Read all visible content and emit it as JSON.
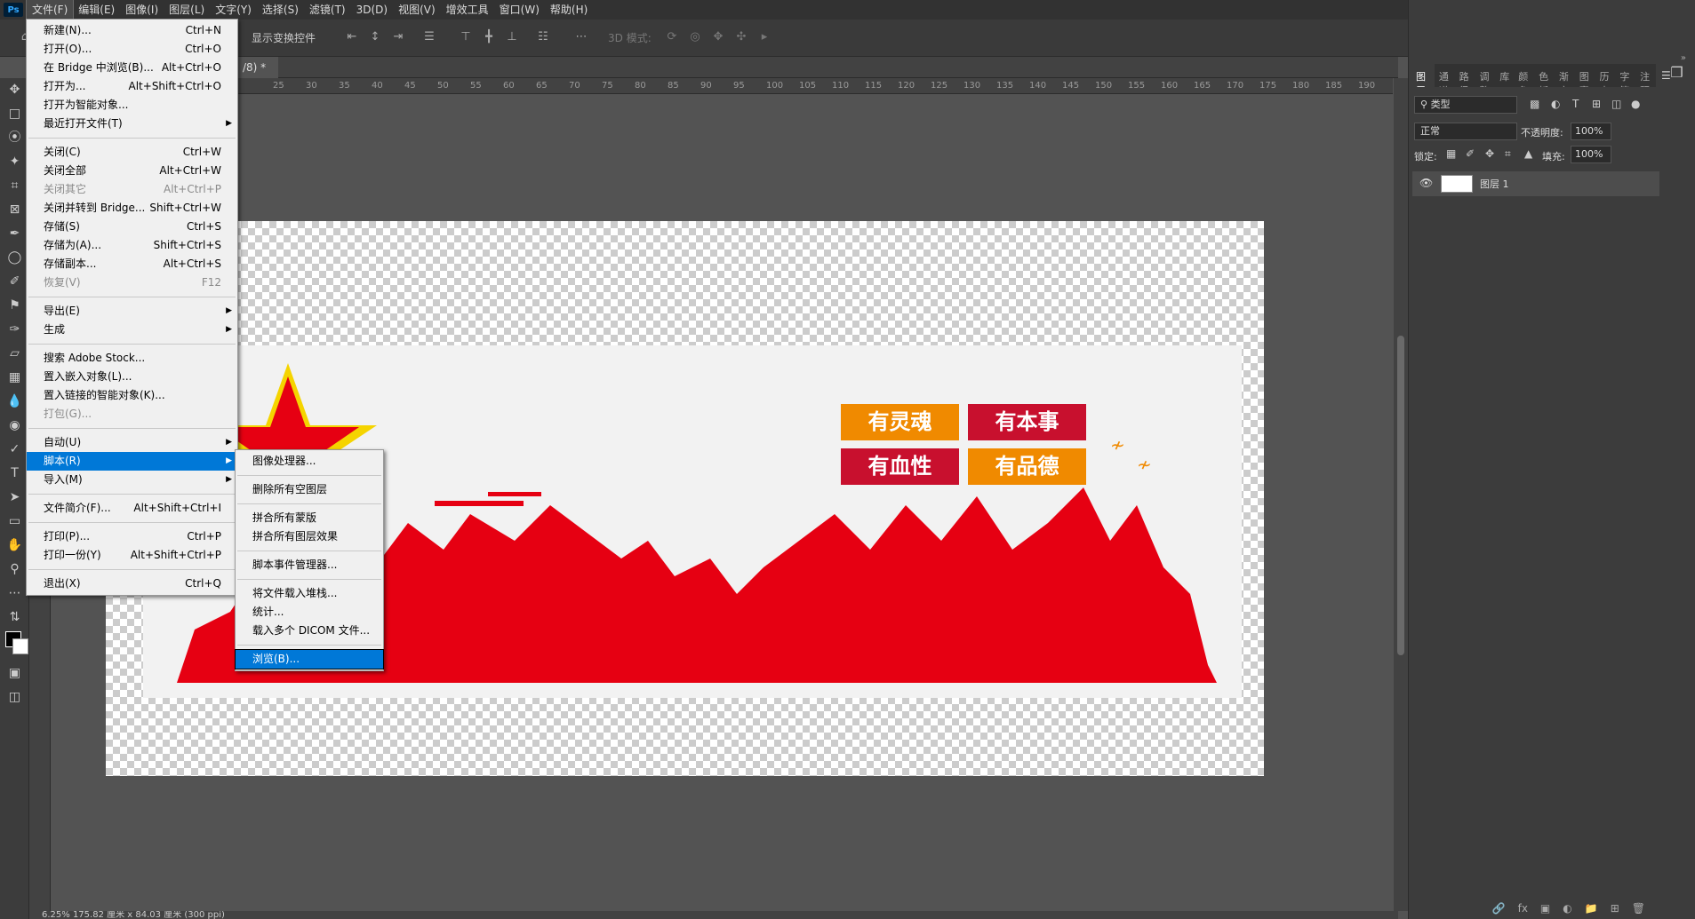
{
  "app": {
    "logo": "Ps"
  },
  "menubar": [
    "文件(F)",
    "编辑(E)",
    "图像(I)",
    "图层(L)",
    "文字(Y)",
    "选择(S)",
    "滤镜(T)",
    "3D(D)",
    "视图(V)",
    "增效工具",
    "窗口(W)",
    "帮助(H)"
  ],
  "options": {
    "show_transform": "显示变换控件",
    "mode3d": "3D 模式:"
  },
  "doc_tab": {
    "title": "/8) *"
  },
  "ruler_ticks": [
    "25",
    "30",
    "35",
    "40",
    "45",
    "50",
    "55",
    "60",
    "65",
    "70",
    "75",
    "80",
    "85",
    "90",
    "95",
    "100",
    "105",
    "110",
    "115",
    "120",
    "125",
    "130",
    "135",
    "140",
    "145",
    "150",
    "155",
    "160",
    "165",
    "170",
    "175",
    "180",
    "185",
    "190"
  ],
  "file_menu": [
    {
      "label": "新建(N)...",
      "shortcut": "Ctrl+N"
    },
    {
      "label": "打开(O)...",
      "shortcut": "Ctrl+O"
    },
    {
      "label": "在 Bridge 中浏览(B)...",
      "shortcut": "Alt+Ctrl+O"
    },
    {
      "label": "打开为...",
      "shortcut": "Alt+Shift+Ctrl+O"
    },
    {
      "label": "打开为智能对象...",
      "shortcut": ""
    },
    {
      "label": "最近打开文件(T)",
      "shortcut": ""
    },
    {
      "label": "关闭(C)",
      "shortcut": "Ctrl+W"
    },
    {
      "label": "关闭全部",
      "shortcut": "Alt+Ctrl+W"
    },
    {
      "label": "关闭其它",
      "shortcut": "Alt+Ctrl+P"
    },
    {
      "label": "关闭并转到 Bridge...",
      "shortcut": "Shift+Ctrl+W"
    },
    {
      "label": "存储(S)",
      "shortcut": "Ctrl+S"
    },
    {
      "label": "存储为(A)...",
      "shortcut": "Shift+Ctrl+S"
    },
    {
      "label": "存储副本...",
      "shortcut": "Alt+Ctrl+S"
    },
    {
      "label": "恢复(V)",
      "shortcut": "F12"
    },
    {
      "label": "导出(E)",
      "shortcut": ""
    },
    {
      "label": "生成",
      "shortcut": ""
    },
    {
      "label": "搜索 Adobe Stock...",
      "shortcut": ""
    },
    {
      "label": "置入嵌入对象(L)...",
      "shortcut": ""
    },
    {
      "label": "置入链接的智能对象(K)...",
      "shortcut": ""
    },
    {
      "label": "打包(G)...",
      "shortcut": ""
    },
    {
      "label": "自动(U)",
      "shortcut": ""
    },
    {
      "label": "脚本(R)",
      "shortcut": ""
    },
    {
      "label": "导入(M)",
      "shortcut": ""
    },
    {
      "label": "文件简介(F)...",
      "shortcut": "Alt+Shift+Ctrl+I"
    },
    {
      "label": "打印(P)...",
      "shortcut": "Ctrl+P"
    },
    {
      "label": "打印一份(Y)",
      "shortcut": "Alt+Shift+Ctrl+P"
    },
    {
      "label": "退出(X)",
      "shortcut": "Ctrl+Q"
    }
  ],
  "script_menu": [
    "图像处理器...",
    "删除所有空图层",
    "拼合所有蒙版",
    "拼合所有图层效果",
    "脚本事件管理器...",
    "将文件载入堆栈...",
    "统计...",
    "载入多个 DICOM 文件...",
    "浏览(B)..."
  ],
  "artwork": {
    "btn1": "有灵魂",
    "btn2": "有本事",
    "btn3": "有血性",
    "btn4": "有品德"
  },
  "panel": {
    "tabs": [
      "图层",
      "通道",
      "路径",
      "调整",
      "库",
      "颜色",
      "色板",
      "渐变",
      "图案",
      "历史",
      "字符",
      "注释"
    ],
    "filter_kind": "类型",
    "blend_mode": "正常",
    "opacity_label": "不透明度:",
    "opacity_value": "100%",
    "lock_label": "锁定:",
    "fill_label": "填充:",
    "fill_value": "100%",
    "layer_name": "图层 1"
  },
  "status": {
    "text": "6.25%   175.82 厘米 x 84.03 厘米 (300 ppi)"
  },
  "colors": {
    "accent": "#0078d7",
    "red": "#e60012",
    "orange": "#f08a00",
    "dark_red": "#c8102e"
  }
}
